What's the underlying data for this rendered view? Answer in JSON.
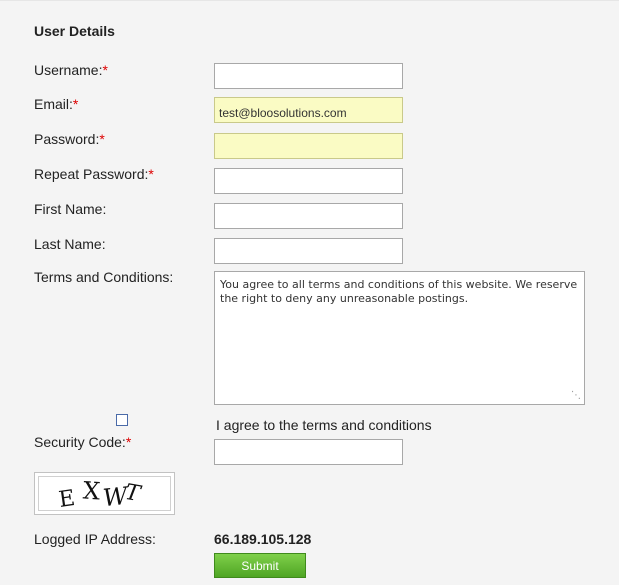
{
  "form": {
    "section_title": "User Details",
    "required_marker": "*",
    "fields": {
      "username": {
        "label": "Username:",
        "value": ""
      },
      "email": {
        "label": "Email:",
        "value": "test@bloosolutions.com"
      },
      "password": {
        "label": "Password:",
        "value": ""
      },
      "repeat_password": {
        "label": "Repeat Password:",
        "value": ""
      },
      "first_name": {
        "label": "First Name:",
        "value": ""
      },
      "last_name": {
        "label": "Last Name:",
        "value": ""
      }
    },
    "terms": {
      "label": "Terms and Conditions:",
      "text": "You agree to all terms and conditions of this website. We reserve the right to deny any unreasonable postings."
    },
    "agree": {
      "label": "I agree to the terms and conditions",
      "checked": false
    },
    "security_code": {
      "label": "Security Code:",
      "value": "",
      "captcha_text": "EXWT"
    },
    "ip": {
      "label": "Logged IP Address:",
      "value": "66.189.105.128"
    },
    "submit_label": "Submit"
  },
  "colors": {
    "required": "#dd0000",
    "autofill": "#fafbc4",
    "submit_button": "#5cb22e"
  }
}
